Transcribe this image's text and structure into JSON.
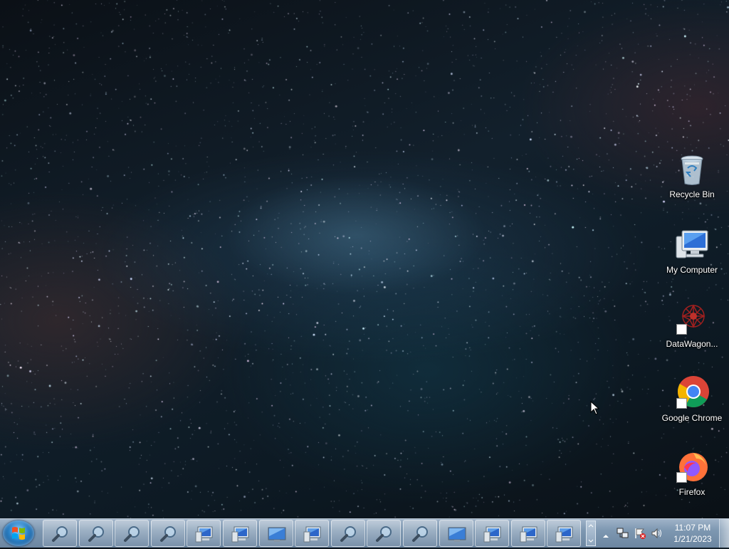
{
  "desktop": {
    "icons": [
      {
        "label": "Recycle Bin",
        "icon": "recycle-bin-icon"
      },
      {
        "label": "My Computer",
        "icon": "computer-icon"
      },
      {
        "label": "DataWagon...",
        "icon": "datawagon-icon"
      },
      {
        "label": "Google Chrome",
        "icon": "chrome-icon"
      },
      {
        "label": "Firefox",
        "icon": "firefox-icon"
      }
    ]
  },
  "taskbar": {
    "start_icon": "windows-logo-icon",
    "items": [
      {
        "icon": "magnifier-icon"
      },
      {
        "icon": "magnifier-icon"
      },
      {
        "icon": "magnifier-icon"
      },
      {
        "icon": "magnifier-icon"
      },
      {
        "icon": "remote-desktop-icon"
      },
      {
        "icon": "remote-desktop-icon"
      },
      {
        "icon": "monitor-icon"
      },
      {
        "icon": "remote-desktop-icon"
      },
      {
        "icon": "magnifier-icon"
      },
      {
        "icon": "magnifier-icon"
      },
      {
        "icon": "magnifier-icon"
      },
      {
        "icon": "monitor-icon"
      },
      {
        "icon": "remote-desktop-icon"
      },
      {
        "icon": "remote-desktop-icon"
      },
      {
        "icon": "remote-desktop-icon"
      }
    ],
    "tray": {
      "icons": [
        "show-hidden-icons-arrow",
        "network-icon",
        "action-center-flag-icon",
        "volume-icon"
      ],
      "time": "11:07 PM",
      "date": "1/21/2023"
    }
  },
  "colors": {
    "taskbar": "#7d97b1",
    "label_text": "#ffffff"
  }
}
